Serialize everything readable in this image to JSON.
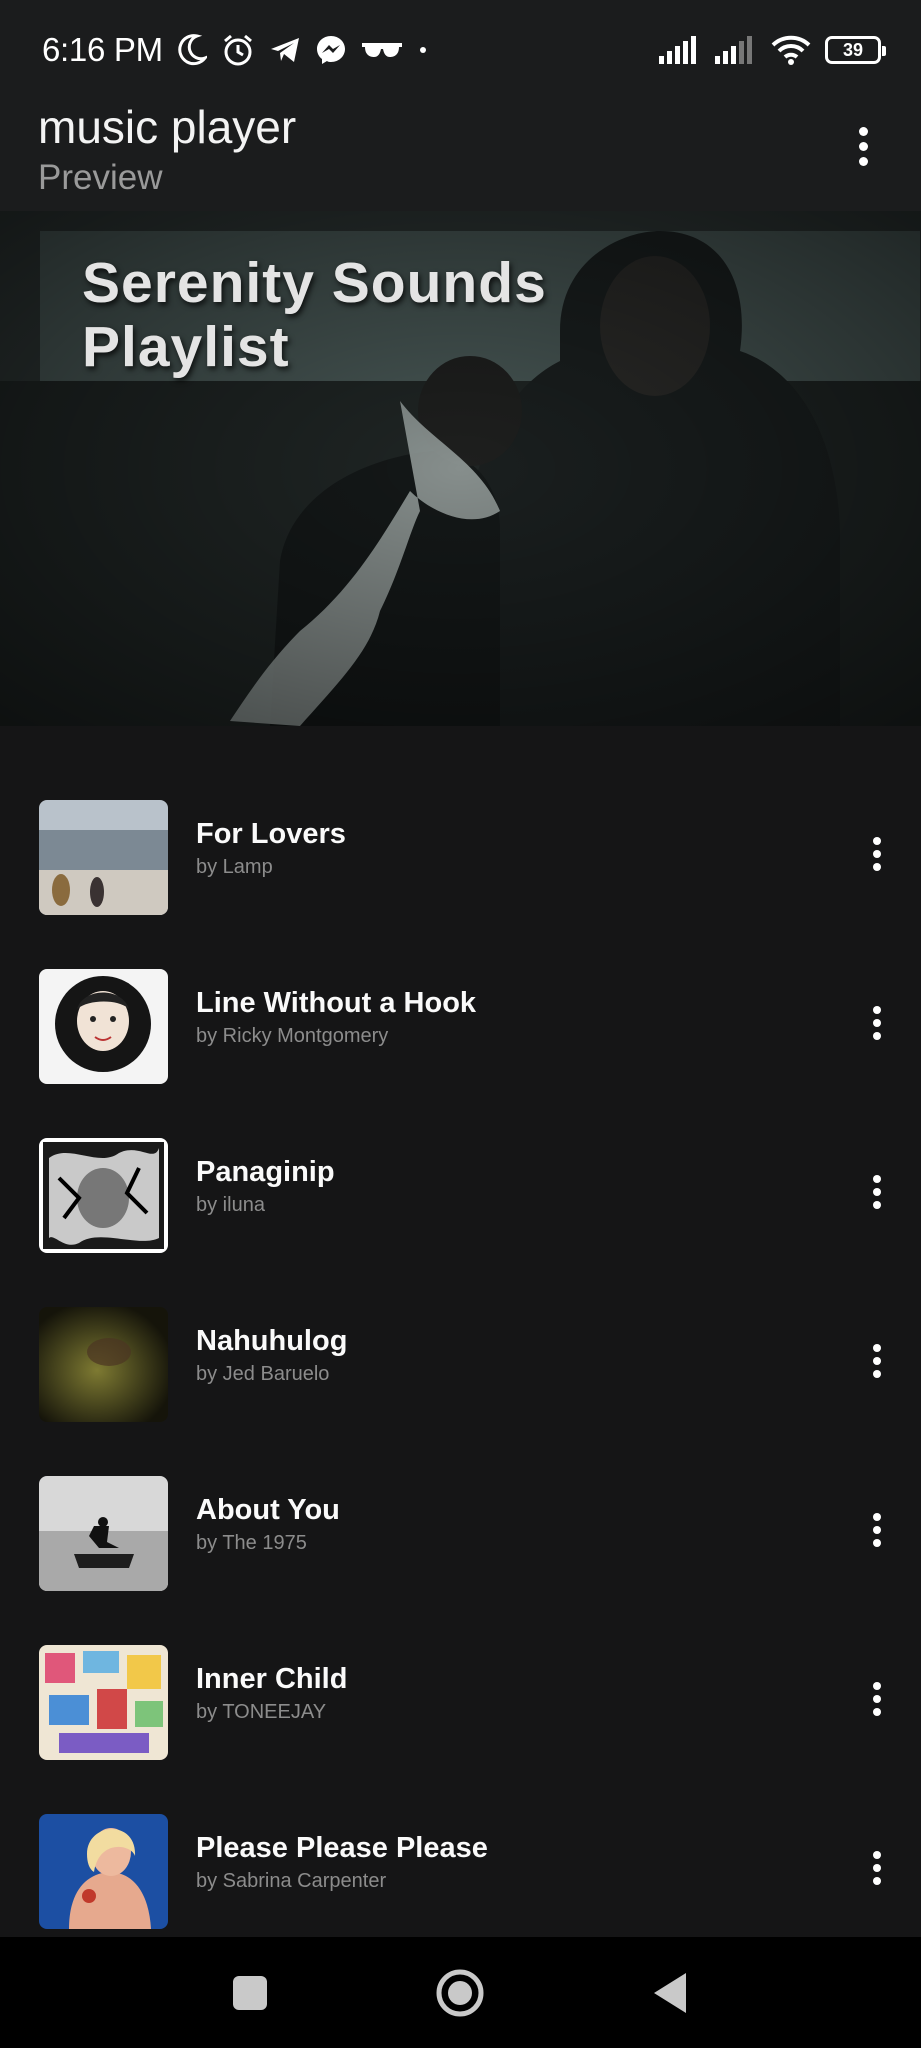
{
  "status_bar": {
    "time": "6:16 PM",
    "battery": "39",
    "left_icons": [
      "moon-icon",
      "alarm-icon",
      "telegram-icon",
      "messenger-icon",
      "glasses-icon",
      "dot-icon"
    ],
    "right_icons": [
      "signal-icon",
      "signal-icon",
      "wifi-icon",
      "battery-icon"
    ]
  },
  "app_bar": {
    "title": "music player",
    "subtitle": "Preview",
    "menu_icon": "more-vert-icon"
  },
  "hero": {
    "title": "Serenity Sounds Playlist"
  },
  "tracks": [
    {
      "title": "For Lovers",
      "artist": "by Lamp"
    },
    {
      "title": "Line Without a Hook",
      "artist": "by Ricky Montgomery"
    },
    {
      "title": "Panaginip",
      "artist": "by iluna"
    },
    {
      "title": "Nahuhulog",
      "artist": "by Jed Baruelo"
    },
    {
      "title": "About You",
      "artist": "by The 1975"
    },
    {
      "title": "Inner Child",
      "artist": "by TONEEJAY"
    },
    {
      "title": "Please Please Please",
      "artist": "by Sabrina Carpenter"
    }
  ],
  "nav_bar": {
    "icons": [
      "recents-square-icon",
      "home-circle-icon",
      "back-triangle-icon"
    ]
  },
  "colors": {
    "background": "#151516",
    "app_bar": "#1b1c1d",
    "secondary_text": "#8c8c8c"
  }
}
